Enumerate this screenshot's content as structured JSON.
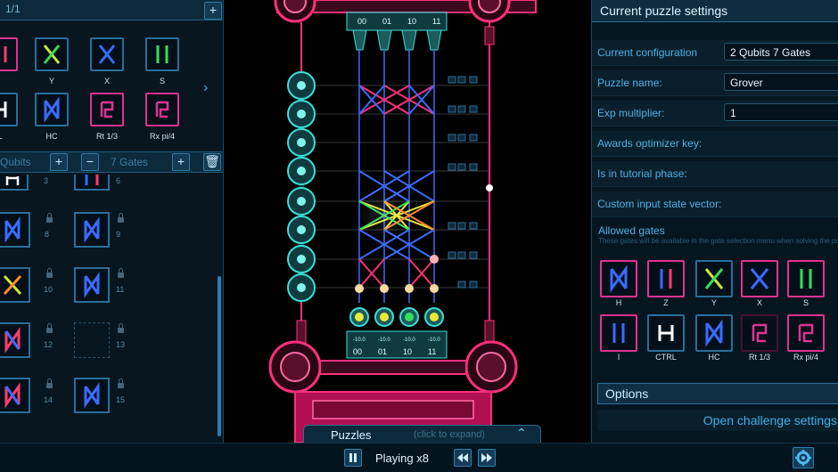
{
  "left_panel": {
    "header_title": "1/1",
    "palette": [
      {
        "label": "Y",
        "icon": "y-gate-icon",
        "color": "#33e05a"
      },
      {
        "label": "X",
        "icon": "x-gate-icon",
        "color": "#3a6cff"
      },
      {
        "label": "S",
        "icon": "s-gate-icon",
        "color": "#33e05a"
      },
      {
        "label": "RL",
        "icon": "ctrl-gate-icon",
        "color": "#ffffff"
      },
      {
        "label": "HC",
        "icon": "hc-gate-icon",
        "color": "#3a6cff"
      },
      {
        "label": "Rt 1/3",
        "icon": "rt-gate-icon",
        "color": "#e0338f"
      },
      {
        "label": "Rx pi/4",
        "icon": "rx-gate-icon",
        "color": "#e0338f"
      }
    ],
    "qubits_label": "Qubits",
    "gates_label": "7 Gates",
    "slot_numbers": [
      "3",
      "6",
      "8",
      "9",
      "10",
      "11",
      "12",
      "13",
      "14",
      "15"
    ]
  },
  "right_panel": {
    "title": "Current puzzle settings",
    "rows": [
      {
        "label": "Current configuration",
        "value": "2 Qubits   7 Gates"
      },
      {
        "label": "Puzzle name:",
        "value": "Grover"
      },
      {
        "label": "Exp multiplier:",
        "value": "1"
      },
      {
        "label": "Awards optimizer key:",
        "value": ""
      },
      {
        "label": "Is in tutorial phase:",
        "value": ""
      },
      {
        "label": "Custom input state vector:",
        "value": ""
      }
    ],
    "allowed_gates_title": "Allowed gates",
    "allowed_gates_desc": "These gates will be available in the gate selection menu when solving the puzzle",
    "allowed_gates": [
      {
        "label": "H",
        "selected": true,
        "color": "#3a6cff"
      },
      {
        "label": "Z",
        "selected": true,
        "color": "#3a6cff"
      },
      {
        "label": "Y",
        "selected": false,
        "color": "#33e05a"
      },
      {
        "label": "X",
        "selected": true,
        "color": "#3a6cff"
      },
      {
        "label": "S",
        "selected": true,
        "color": "#33e05a"
      },
      {
        "label": "I",
        "selected": true,
        "color": "#3a6cff"
      },
      {
        "label": "CTRL",
        "selected": false,
        "color": "#ffffff"
      },
      {
        "label": "HC",
        "selected": false,
        "color": "#3a6cff"
      },
      {
        "label": "Rt 1/3",
        "selected": false,
        "color": "#e0338f"
      },
      {
        "label": "Rx pi/4",
        "selected": true,
        "color": "#e0338f"
      }
    ],
    "options_label": "Options",
    "challenge_label": "Open challenge settings"
  },
  "circuit": {
    "top_states": [
      "00",
      "01",
      "10",
      "11"
    ],
    "bottom_states": [
      "00",
      "01",
      "10",
      "11"
    ],
    "bottom_values": [
      "-10.0",
      "-10.0",
      "-10.0",
      "-10.0"
    ],
    "accent_pink": "#ff2f7d",
    "accent_cyan": "#38e0d8"
  },
  "bottom_bar": {
    "puzzles_label": "Puzzles",
    "expand_hint": "(click to expand)",
    "playing_label": "Playing x8"
  }
}
